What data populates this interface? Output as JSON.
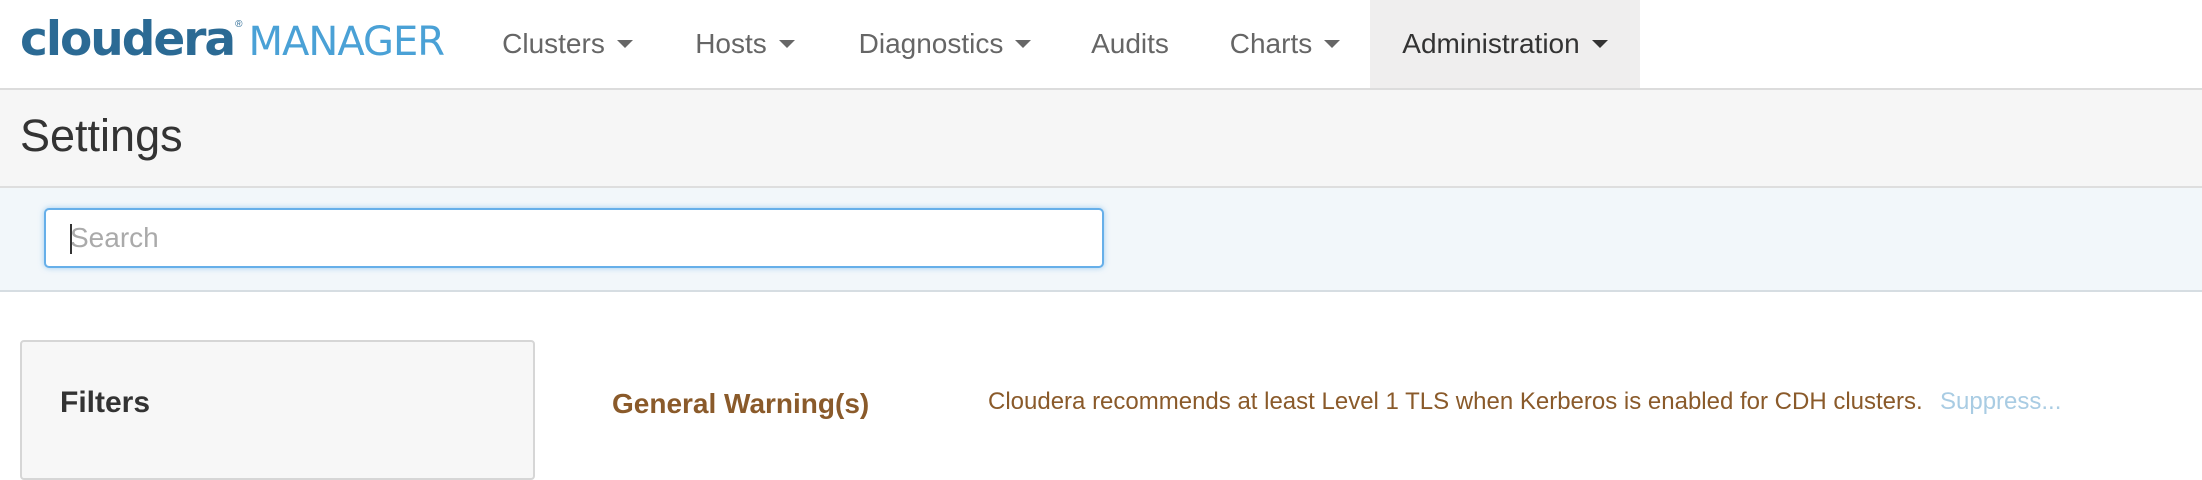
{
  "logo": {
    "brand": "cloudera",
    "tm": "®",
    "product": "MANAGER"
  },
  "nav": {
    "items": [
      {
        "label": "Clusters",
        "dropdown": true
      },
      {
        "label": "Hosts",
        "dropdown": true
      },
      {
        "label": "Diagnostics",
        "dropdown": true
      },
      {
        "label": "Audits",
        "dropdown": false
      },
      {
        "label": "Charts",
        "dropdown": true
      },
      {
        "label": "Administration",
        "dropdown": true,
        "active": true
      }
    ]
  },
  "page": {
    "title": "Settings"
  },
  "search": {
    "placeholder": "Search",
    "value": ""
  },
  "filters": {
    "title": "Filters"
  },
  "warnings": {
    "title": "General Warning(s)",
    "message": "Cloudera recommends at least Level 1 TLS when Kerberos is enabled for CDH clusters.",
    "suppress_label": "Suppress..."
  },
  "colors": {
    "brand": "#2b6a94",
    "product": "#4aa1d6",
    "warning": "#8a5a2a",
    "link_muted": "#a9cce3",
    "focus": "#66afe9"
  }
}
